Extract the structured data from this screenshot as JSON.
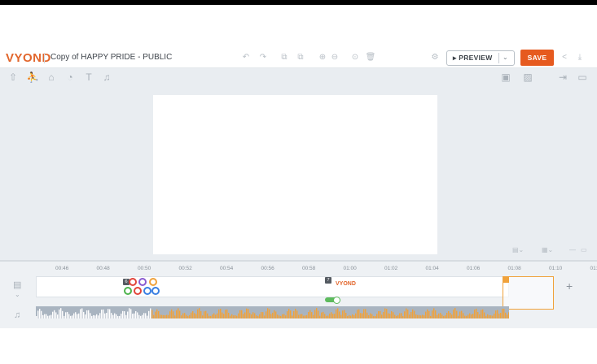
{
  "header": {
    "logo": "VYOND",
    "title": "Copy of HAPPY PRIDE - PUBLIC",
    "preview_label": "▸ PREVIEW",
    "save_label": "SAVE"
  },
  "icons": {
    "undo": "↶",
    "redo": "↷",
    "copy": "⧉",
    "paste": "⧉",
    "group": "⊕",
    "ungroup": "⊖",
    "order": "⊙",
    "delete": "🗑",
    "settings": "⚙",
    "share": "<",
    "download": "⤓",
    "upload": "⇧",
    "character": "⛹",
    "props": "⌂",
    "chart": "◔",
    "text": "T",
    "music": "♫",
    "background": "▣",
    "image": "▨",
    "export": "⇥",
    "video": "▭",
    "chevron": "⌄"
  },
  "timeline": {
    "ticks": [
      "00:46",
      "00:48",
      "00:50",
      "00:52",
      "00:54",
      "00:56",
      "00:58",
      "01:00",
      "01:02",
      "01:04",
      "01:06",
      "01:08",
      "01:10",
      "01:1"
    ],
    "scene_badges": [
      "6",
      "7",
      "8"
    ],
    "mini_logo": "VYOND",
    "add_label": "+"
  },
  "colors": {
    "accent": "#e65a1f",
    "selection": "#f0a23b",
    "stage_bg": "#e9edf1"
  }
}
